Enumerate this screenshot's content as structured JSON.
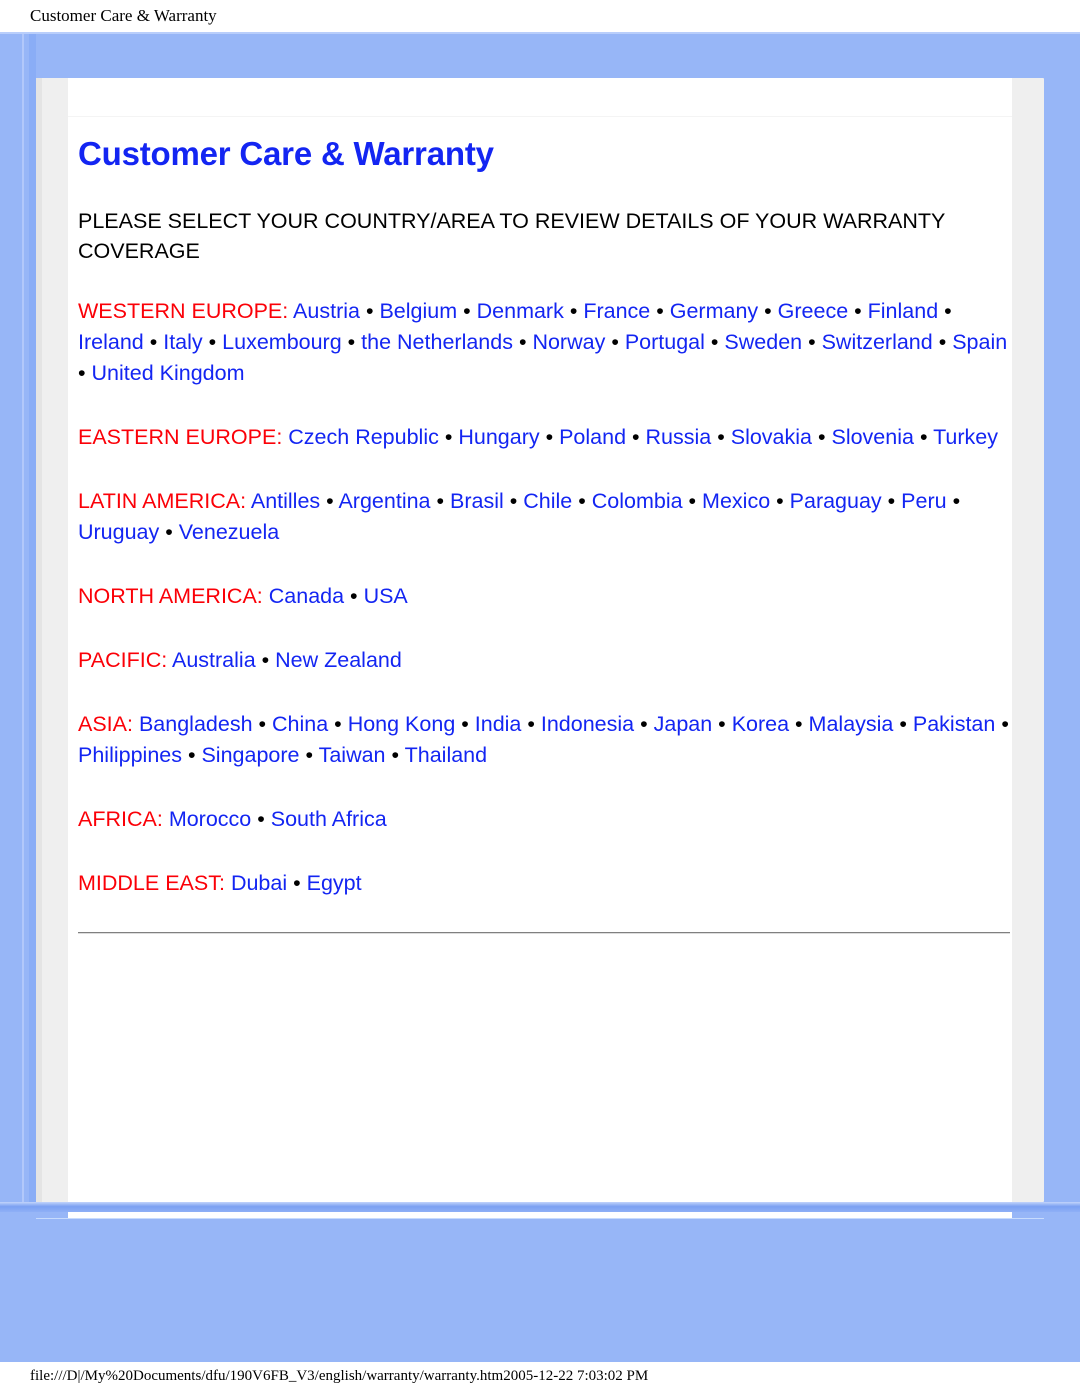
{
  "print_header": {
    "title": "Customer Care & Warranty"
  },
  "document": {
    "title": "Customer Care & Warranty",
    "intro": "PLEASE SELECT YOUR COUNTRY/AREA TO REVIEW DETAILS OF YOUR WARRANTY COVERAGE",
    "separator": "•",
    "regions": [
      {
        "label": "WESTERN EUROPE:",
        "countries": [
          "Austria",
          "Belgium",
          "Denmark",
          "France",
          "Germany",
          "Greece",
          "Finland",
          "Ireland",
          "Italy",
          "Luxembourg",
          "the Netherlands",
          "Norway",
          "Portugal",
          "Sweden",
          "Switzerland",
          "Spain",
          "United Kingdom"
        ]
      },
      {
        "label": "EASTERN EUROPE:",
        "countries": [
          "Czech Republic",
          "Hungary",
          "Poland",
          "Russia",
          "Slovakia",
          "Slovenia",
          "Turkey"
        ]
      },
      {
        "label": "LATIN AMERICA:",
        "countries": [
          "Antilles",
          "Argentina",
          "Brasil",
          "Chile",
          "Colombia",
          "Mexico",
          "Paraguay",
          "Peru",
          "Uruguay",
          "Venezuela"
        ]
      },
      {
        "label": "NORTH AMERICA:",
        "countries": [
          "Canada",
          "USA"
        ]
      },
      {
        "label": "PACIFIC:",
        "countries": [
          "Australia",
          "New Zealand"
        ]
      },
      {
        "label": "ASIA:",
        "countries": [
          "Bangladesh",
          "China",
          "Hong Kong",
          "India",
          "Indonesia",
          "Japan",
          "Korea",
          "Malaysia",
          "Pakistan",
          "Philippines",
          "Singapore",
          "Taiwan",
          "Thailand"
        ]
      },
      {
        "label": "AFRICA:",
        "countries": [
          "Morocco",
          "South Africa"
        ]
      },
      {
        "label": "MIDDLE EAST:",
        "countries": [
          "Dubai",
          "Egypt"
        ]
      }
    ]
  },
  "print_footer": {
    "text": "file:///D|/My%20Documents/dfu/190V6FB_V3/english/warranty/warranty.htm2005-12-22 7:03:02 PM"
  },
  "colors": {
    "title_blue": "#1325f2",
    "link_blue": "#1325f2",
    "region_red": "#fb0007",
    "canvas_blue": "#97b6f7",
    "sheet_grey": "#efefef",
    "sheet_white": "#ffffff"
  }
}
